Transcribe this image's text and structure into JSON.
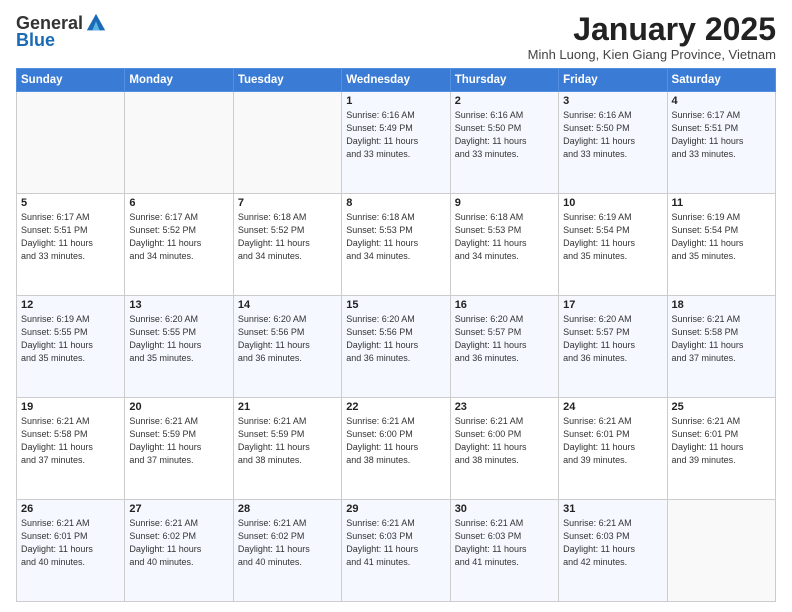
{
  "header": {
    "logo": {
      "general": "General",
      "blue": "Blue"
    },
    "title": "January 2025",
    "subtitle": "Minh Luong, Kien Giang Province, Vietnam"
  },
  "calendar": {
    "days_of_week": [
      "Sunday",
      "Monday",
      "Tuesday",
      "Wednesday",
      "Thursday",
      "Friday",
      "Saturday"
    ],
    "weeks": [
      [
        {
          "day": "",
          "info": ""
        },
        {
          "day": "",
          "info": ""
        },
        {
          "day": "",
          "info": ""
        },
        {
          "day": "1",
          "info": "Sunrise: 6:16 AM\nSunset: 5:49 PM\nDaylight: 11 hours\nand 33 minutes."
        },
        {
          "day": "2",
          "info": "Sunrise: 6:16 AM\nSunset: 5:50 PM\nDaylight: 11 hours\nand 33 minutes."
        },
        {
          "day": "3",
          "info": "Sunrise: 6:16 AM\nSunset: 5:50 PM\nDaylight: 11 hours\nand 33 minutes."
        },
        {
          "day": "4",
          "info": "Sunrise: 6:17 AM\nSunset: 5:51 PM\nDaylight: 11 hours\nand 33 minutes."
        }
      ],
      [
        {
          "day": "5",
          "info": "Sunrise: 6:17 AM\nSunset: 5:51 PM\nDaylight: 11 hours\nand 33 minutes."
        },
        {
          "day": "6",
          "info": "Sunrise: 6:17 AM\nSunset: 5:52 PM\nDaylight: 11 hours\nand 34 minutes."
        },
        {
          "day": "7",
          "info": "Sunrise: 6:18 AM\nSunset: 5:52 PM\nDaylight: 11 hours\nand 34 minutes."
        },
        {
          "day": "8",
          "info": "Sunrise: 6:18 AM\nSunset: 5:53 PM\nDaylight: 11 hours\nand 34 minutes."
        },
        {
          "day": "9",
          "info": "Sunrise: 6:18 AM\nSunset: 5:53 PM\nDaylight: 11 hours\nand 34 minutes."
        },
        {
          "day": "10",
          "info": "Sunrise: 6:19 AM\nSunset: 5:54 PM\nDaylight: 11 hours\nand 35 minutes."
        },
        {
          "day": "11",
          "info": "Sunrise: 6:19 AM\nSunset: 5:54 PM\nDaylight: 11 hours\nand 35 minutes."
        }
      ],
      [
        {
          "day": "12",
          "info": "Sunrise: 6:19 AM\nSunset: 5:55 PM\nDaylight: 11 hours\nand 35 minutes."
        },
        {
          "day": "13",
          "info": "Sunrise: 6:20 AM\nSunset: 5:55 PM\nDaylight: 11 hours\nand 35 minutes."
        },
        {
          "day": "14",
          "info": "Sunrise: 6:20 AM\nSunset: 5:56 PM\nDaylight: 11 hours\nand 36 minutes."
        },
        {
          "day": "15",
          "info": "Sunrise: 6:20 AM\nSunset: 5:56 PM\nDaylight: 11 hours\nand 36 minutes."
        },
        {
          "day": "16",
          "info": "Sunrise: 6:20 AM\nSunset: 5:57 PM\nDaylight: 11 hours\nand 36 minutes."
        },
        {
          "day": "17",
          "info": "Sunrise: 6:20 AM\nSunset: 5:57 PM\nDaylight: 11 hours\nand 36 minutes."
        },
        {
          "day": "18",
          "info": "Sunrise: 6:21 AM\nSunset: 5:58 PM\nDaylight: 11 hours\nand 37 minutes."
        }
      ],
      [
        {
          "day": "19",
          "info": "Sunrise: 6:21 AM\nSunset: 5:58 PM\nDaylight: 11 hours\nand 37 minutes."
        },
        {
          "day": "20",
          "info": "Sunrise: 6:21 AM\nSunset: 5:59 PM\nDaylight: 11 hours\nand 37 minutes."
        },
        {
          "day": "21",
          "info": "Sunrise: 6:21 AM\nSunset: 5:59 PM\nDaylight: 11 hours\nand 38 minutes."
        },
        {
          "day": "22",
          "info": "Sunrise: 6:21 AM\nSunset: 6:00 PM\nDaylight: 11 hours\nand 38 minutes."
        },
        {
          "day": "23",
          "info": "Sunrise: 6:21 AM\nSunset: 6:00 PM\nDaylight: 11 hours\nand 38 minutes."
        },
        {
          "day": "24",
          "info": "Sunrise: 6:21 AM\nSunset: 6:01 PM\nDaylight: 11 hours\nand 39 minutes."
        },
        {
          "day": "25",
          "info": "Sunrise: 6:21 AM\nSunset: 6:01 PM\nDaylight: 11 hours\nand 39 minutes."
        }
      ],
      [
        {
          "day": "26",
          "info": "Sunrise: 6:21 AM\nSunset: 6:01 PM\nDaylight: 11 hours\nand 40 minutes."
        },
        {
          "day": "27",
          "info": "Sunrise: 6:21 AM\nSunset: 6:02 PM\nDaylight: 11 hours\nand 40 minutes."
        },
        {
          "day": "28",
          "info": "Sunrise: 6:21 AM\nSunset: 6:02 PM\nDaylight: 11 hours\nand 40 minutes."
        },
        {
          "day": "29",
          "info": "Sunrise: 6:21 AM\nSunset: 6:03 PM\nDaylight: 11 hours\nand 41 minutes."
        },
        {
          "day": "30",
          "info": "Sunrise: 6:21 AM\nSunset: 6:03 PM\nDaylight: 11 hours\nand 41 minutes."
        },
        {
          "day": "31",
          "info": "Sunrise: 6:21 AM\nSunset: 6:03 PM\nDaylight: 11 hours\nand 42 minutes."
        },
        {
          "day": "",
          "info": ""
        }
      ]
    ]
  }
}
